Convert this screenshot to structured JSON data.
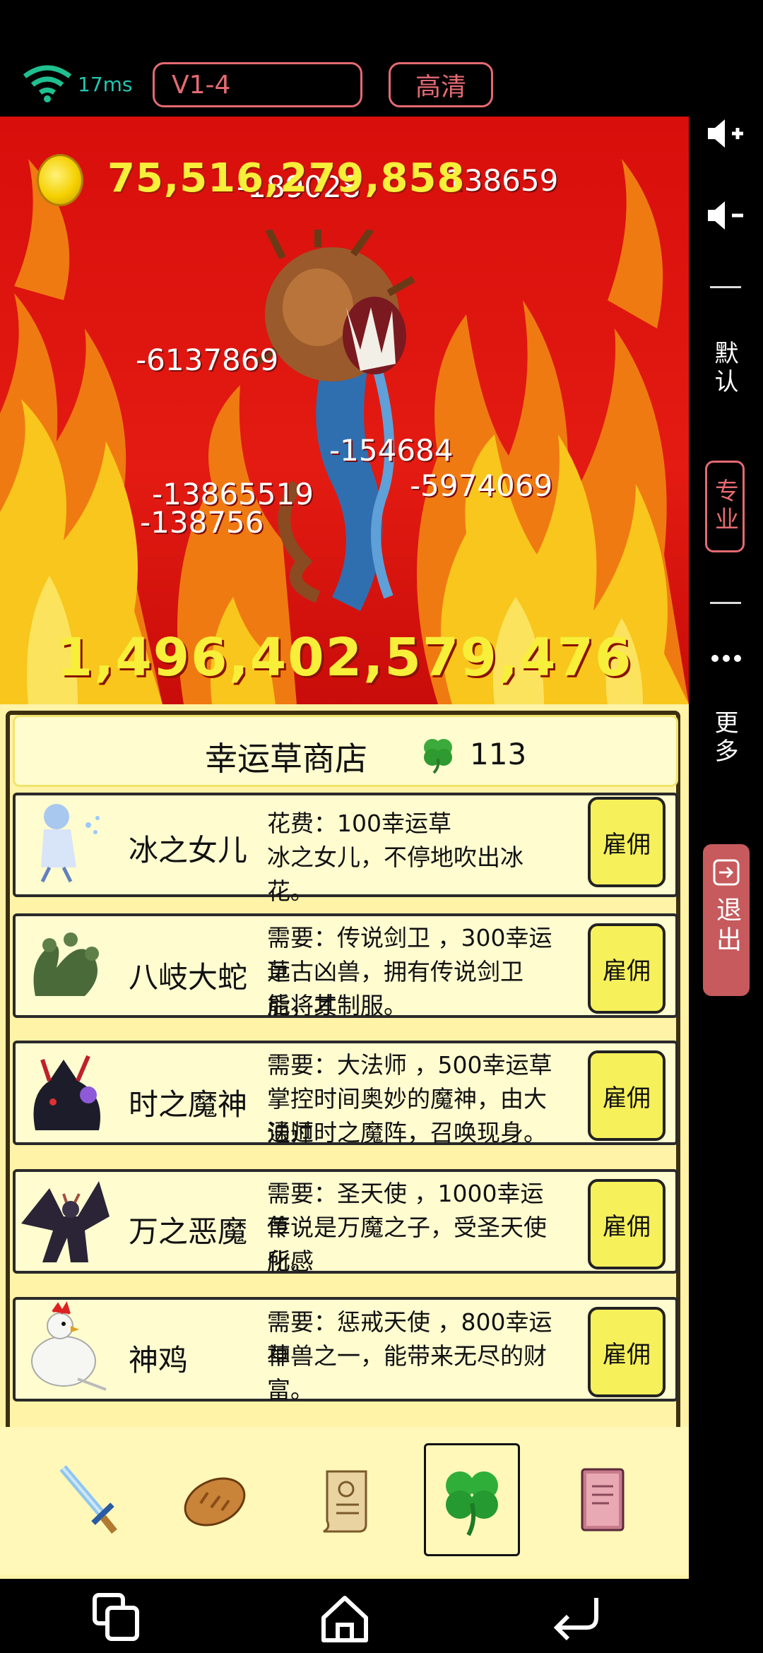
{
  "status": {
    "latency": "17ms",
    "version": "V1-4",
    "quality": "高清"
  },
  "side": {
    "vol_up": "volume-up",
    "vol_down": "volume-down",
    "default_label": "默认",
    "pro_label": "专业",
    "more_label": "更多",
    "exit_label": "退出"
  },
  "battle": {
    "gold": "75,516,279,858",
    "boss_hp": "1,496,402,579,476",
    "damage": [
      "-189028",
      "138659",
      "-6137869",
      "-154684",
      "-13865519",
      "-5974069",
      "-138756"
    ]
  },
  "shop": {
    "title": "幸运草商店",
    "clover_count": "113",
    "items": [
      {
        "name": "冰之女儿",
        "desc1": "花费：100幸运草",
        "desc2": "冰之女儿，不停地吹出冰花。",
        "desc3": "",
        "button": "雇佣"
      },
      {
        "name": "八岐大蛇",
        "desc1": "需要：传说剑卫 ，300幸运草",
        "desc2": "远古凶兽，拥有传说剑卫后，才",
        "desc3": "能将其制服。",
        "button": "雇佣"
      },
      {
        "name": "时之魔神",
        "desc1": "需要：大法师 ，500幸运草",
        "desc2": "掌控时间奥妙的魔神，由大法师",
        "desc3": "通过时之魔阵，召唤现身。",
        "button": "雇佣"
      },
      {
        "name": "万之恶魔",
        "desc1": "需要：圣天使 ，1000幸运草",
        "desc2": "传说是万魔之子，受圣天使所感",
        "desc3": "化。",
        "button": "雇佣"
      },
      {
        "name": "神鸡",
        "desc1": "需要：惩戒天使 ，800幸运草",
        "desc2": "神兽之一，能带来无尽的财富。",
        "desc3": "",
        "button": "雇佣"
      }
    ]
  },
  "tabs": [
    "sword-icon",
    "bread-icon",
    "scroll-icon",
    "clover-icon",
    "book-icon"
  ],
  "nav": [
    "recent-apps-icon",
    "home-icon",
    "back-icon"
  ],
  "colors": {
    "accent": "#e46a72",
    "gold": "#f7ef3a",
    "scene_red": "#e31b12",
    "panel": "#fff3a8"
  }
}
